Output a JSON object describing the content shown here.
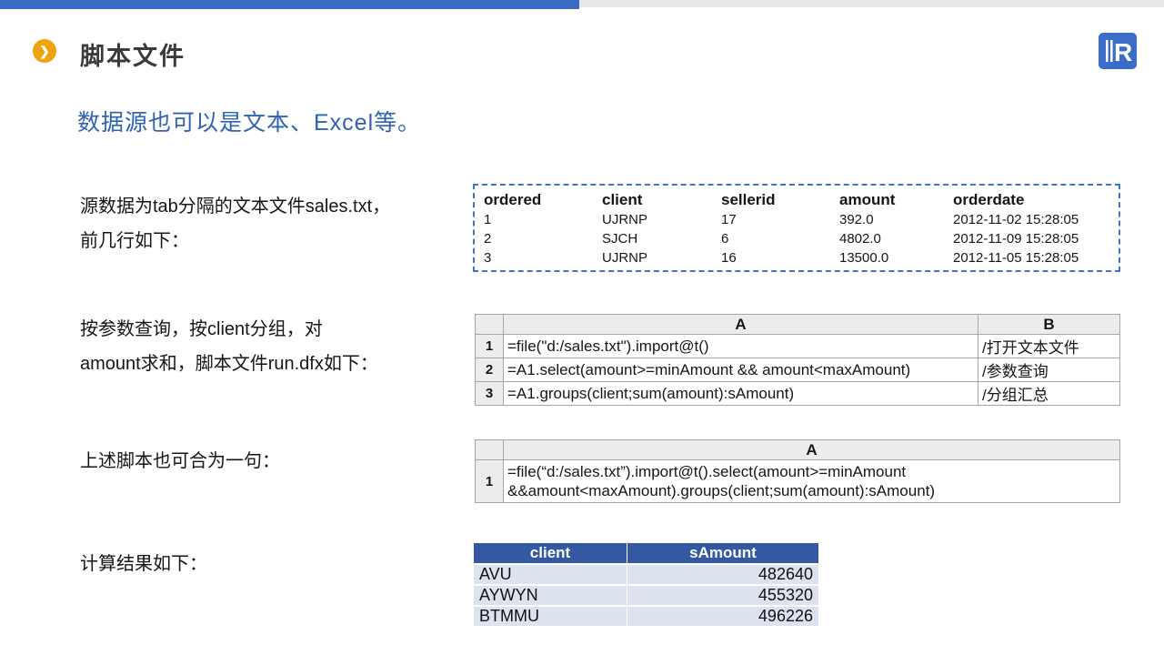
{
  "slide": {
    "title": "脚本文件",
    "subtitle": "数据源也可以是文本、Excel等。",
    "title_icon": "❯",
    "logo_letter": "R"
  },
  "paragraphs": {
    "p1_line1": "源数据为tab分隔的文本文件sales.txt，",
    "p1_line2": "前几行如下：",
    "p2_line1": "按参数查询，按client分组，对",
    "p2_line2": "amount求和，脚本文件run.dfx如下：",
    "p3": "上述脚本也可合为一句：",
    "p4": "计算结果如下："
  },
  "sales_table": {
    "headers": [
      "ordered",
      "client",
      "sellerid",
      "amount",
      "orderdate"
    ],
    "rows": [
      [
        "1",
        "UJRNP",
        "17",
        "392.0",
        "2012-11-02 15:28:05"
      ],
      [
        "2",
        "SJCH",
        "6",
        "4802.0",
        "2012-11-09 15:28:05"
      ],
      [
        "3",
        "UJRNP",
        "16",
        "13500.0",
        "2012-11-05 15:28:05"
      ]
    ]
  },
  "script_table": {
    "col_a": "A",
    "col_b": "B",
    "rows": [
      {
        "num": "1",
        "a": "=file(\"d:/sales.txt\").import@t()",
        "b": "/打开文本文件"
      },
      {
        "num": "2",
        "a": "=A1.select(amount>=minAmount && amount<maxAmount)",
        "b": "/参数查询"
      },
      {
        "num": "3",
        "a": "=A1.groups(client;sum(amount):sAmount)",
        "b": "/分组汇总"
      }
    ]
  },
  "oneliner_table": {
    "col_a": "A",
    "row_num": "1",
    "line1": "=file(“d:/sales.txt”).import@t().select(amount>=minAmount",
    "line2": "&&amount<maxAmount).groups(client;sum(amount):sAmount)"
  },
  "result_table": {
    "headers": [
      "client",
      "sAmount"
    ],
    "rows": [
      [
        "AVU",
        "482640"
      ],
      [
        "AYWYN",
        "455320"
      ],
      [
        "BTMMU",
        "496226"
      ]
    ]
  },
  "colors": {
    "accent_blue": "#3a6cc6",
    "subtitle_blue": "#2f62b4",
    "dashed_border": "#4472c4",
    "result_header_blue": "#3459a2",
    "result_row_blue": "#dce3ef",
    "icon_orange": "#f0a30d"
  }
}
